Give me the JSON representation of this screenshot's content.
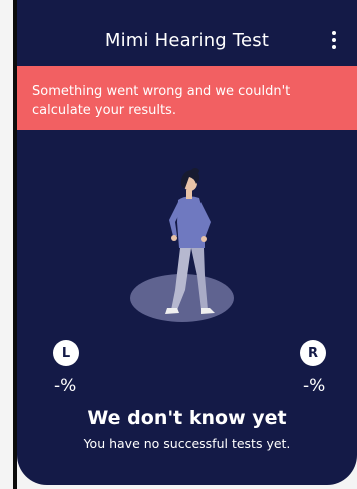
{
  "header": {
    "title": "Mimi Hearing Test",
    "menu_icon": "more-vertical-icon"
  },
  "error": {
    "message": "Something went wrong and we couldn't calculate your results."
  },
  "illustration": {
    "icon": "person-standing-illustration"
  },
  "results": {
    "left_label": "L",
    "left_value": "-%",
    "right_label": "R",
    "right_value": "-%"
  },
  "status": {
    "headline": "We don't know yet",
    "subline": "You have no successful tests yet."
  },
  "colors": {
    "background": "#141a47",
    "error": "#f26062",
    "text": "#ffffff"
  }
}
